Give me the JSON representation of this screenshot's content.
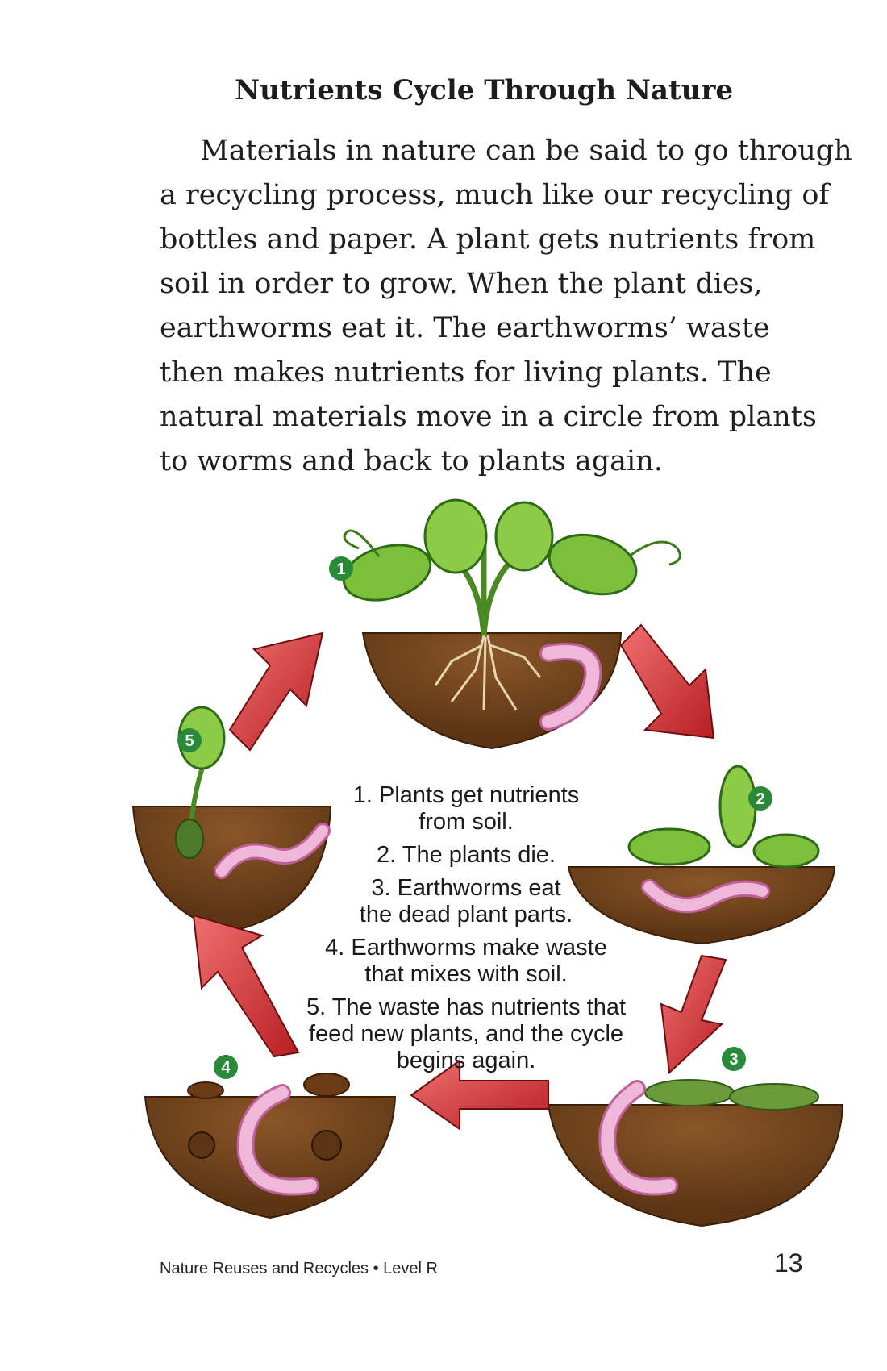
{
  "heading": "Nutrients Cycle Through Nature",
  "paragraph_lines": [
    "Materials in nature can be said to go through",
    "a recycling process, much like our recycling of",
    "bottles and paper. A plant gets nutrients from",
    "soil in order to grow. When the plant dies,",
    "earthworms eat it. The earthworms’ waste",
    "then makes nutrients for living plants. The",
    "natural materials move in a circle from plants",
    "to worms and back to plants again."
  ],
  "steps": [
    {
      "lines": [
        "1. Plants get nutrients",
        "from soil."
      ]
    },
    {
      "lines": [
        "2. The plants die."
      ]
    },
    {
      "lines": [
        "3. Earthworms eat",
        "the dead plant parts."
      ]
    },
    {
      "lines": [
        "4. Earthworms make waste",
        "that mixes with soil."
      ]
    },
    {
      "lines": [
        "5. The waste has nutrients that",
        "feed new plants, and the cycle",
        "begins again."
      ]
    }
  ],
  "badges": [
    "1",
    "2",
    "3",
    "4",
    "5"
  ],
  "footer": {
    "book_title": "Nature Reuses and Recycles • Level R",
    "page_number": "13"
  },
  "colors": {
    "soil": "#7a4a22",
    "soil_dark": "#5b3414",
    "leaf": "#7bbf3a",
    "leaf_dark": "#2f6a18",
    "worm": "#e8a0c8",
    "arrow": "#d9363a",
    "badge": "#2a8a3a"
  }
}
